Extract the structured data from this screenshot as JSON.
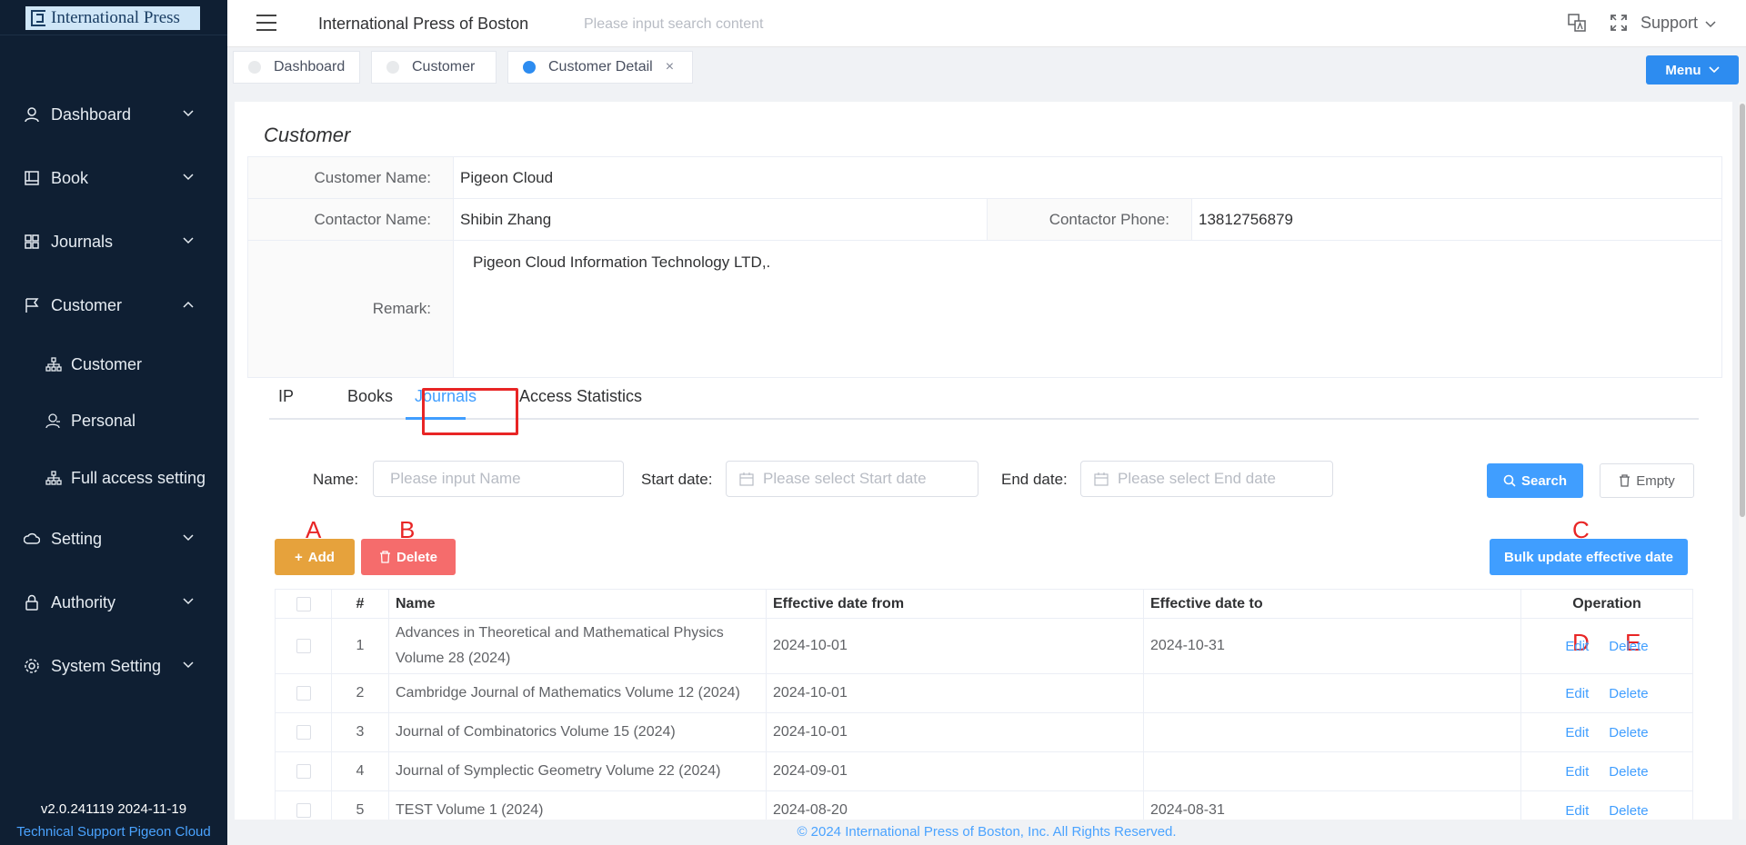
{
  "sidebar": {
    "logo_text": "International Press",
    "items": [
      {
        "label": "Dashboard",
        "icon": "person-icon",
        "expanded": false
      },
      {
        "label": "Book",
        "icon": "book-icon",
        "expanded": false
      },
      {
        "label": "Journals",
        "icon": "grid-icon",
        "expanded": false
      },
      {
        "label": "Customer",
        "icon": "flag-icon",
        "expanded": true
      },
      {
        "label": "Setting",
        "icon": "cloud-gear-icon",
        "expanded": false
      },
      {
        "label": "Authority",
        "icon": "lock-icon",
        "expanded": false
      },
      {
        "label": "System Setting",
        "icon": "gear-icon",
        "expanded": false
      }
    ],
    "sub_items": [
      {
        "label": "Customer",
        "icon": "org-chart-icon"
      },
      {
        "label": "Personal",
        "icon": "user-badge-icon"
      },
      {
        "label": "Full access setting",
        "icon": "org-chart-icon"
      }
    ],
    "version": "v2.0.241119 2024-11-19",
    "tech_support": "Technical Support Pigeon Cloud"
  },
  "header": {
    "title": "International Press of Boston",
    "search_placeholder": "Please input search content",
    "support_label": "Support"
  },
  "tabs": [
    {
      "label": "Dashboard",
      "active": false
    },
    {
      "label": "Customer",
      "active": false
    },
    {
      "label": "Customer Detail",
      "active": true,
      "closable": true
    }
  ],
  "menu_button": "Menu",
  "card": {
    "title": "Customer",
    "customer_name_label": "Customer Name:",
    "customer_name": "Pigeon Cloud",
    "contactor_name_label": "Contactor Name:",
    "contactor_name": "Shibin Zhang",
    "contactor_phone_label": "Contactor Phone:",
    "contactor_phone": "13812756879",
    "remark_label": "Remark:",
    "remark": "Pigeon Cloud Information Technology LTD,."
  },
  "detail_tabs": [
    "IP",
    "Books",
    "Journals",
    "Access Statistics"
  ],
  "active_detail_tab": "Journals",
  "filters": {
    "name_label": "Name:",
    "name_placeholder": "Please input Name",
    "start_label": "Start date:",
    "start_placeholder": "Please select Start date",
    "end_label": "End date:",
    "end_placeholder": "Please select End date",
    "search_btn": "Search",
    "empty_btn": "Empty"
  },
  "actions": {
    "add": "Add",
    "delete": "Delete",
    "bulk": "Bulk update effective date"
  },
  "annotations": {
    "a": "A",
    "b": "B",
    "c": "C",
    "d": "D",
    "e": "E"
  },
  "table": {
    "headers": {
      "num": "#",
      "name": "Name",
      "from": "Effective date from",
      "to": "Effective date to",
      "op": "Operation"
    },
    "edit_label": "Edit",
    "delete_label": "Delete",
    "rows": [
      {
        "num": "1",
        "name": "Advances in Theoretical and Mathematical Physics Volume 28 (2024)",
        "from": "2024-10-01",
        "to": "2024-10-31"
      },
      {
        "num": "2",
        "name": "Cambridge Journal of Mathematics Volume 12 (2024)",
        "from": "2024-10-01",
        "to": ""
      },
      {
        "num": "3",
        "name": "Journal of Combinatorics Volume 15 (2024)",
        "from": "2024-10-01",
        "to": ""
      },
      {
        "num": "4",
        "name": "Journal of Symplectic Geometry Volume 22 (2024)",
        "from": "2024-09-01",
        "to": ""
      },
      {
        "num": "5",
        "name": "TEST Volume 1 (2024)",
        "from": "2024-08-20",
        "to": "2024-08-31"
      }
    ]
  },
  "footer": "© 2024 International Press of Boston, Inc. All Rights Reserved.",
  "colors": {
    "sidebar": "#0f1f33",
    "primary": "#409eff",
    "warning": "#e6a23c",
    "danger": "#f56c6c",
    "annotation": "#e82525"
  }
}
